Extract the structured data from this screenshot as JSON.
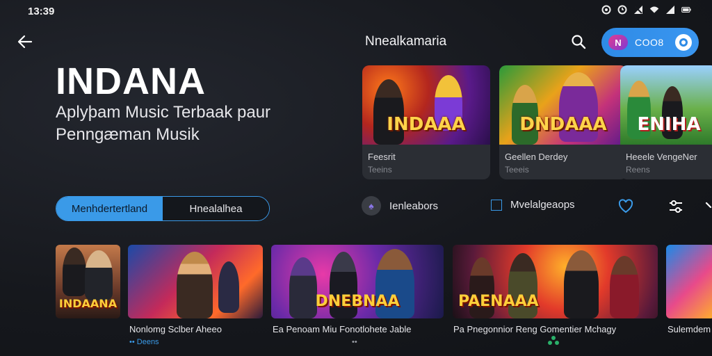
{
  "status_bar": {
    "time": "13:39"
  },
  "header": {
    "title": "Nnealkamaria",
    "account_code": "COO8",
    "account_badge": "N"
  },
  "hero": {
    "title": "INDANA",
    "subtitle": "Aplyþam Music Terbaak paur Penngæman Musik"
  },
  "segmented": {
    "option_1": "Menhdertertland",
    "option_2": "Hnealalhea"
  },
  "featured": [
    {
      "logo": "INDAAA",
      "line1": "Feesrit",
      "line2": "Teeins"
    },
    {
      "logo": "DNDAAA",
      "line1": "Geellen Derdey",
      "line2": "Teeeis"
    },
    {
      "logo": "ENIHA",
      "line1": "Heeele VengeNer",
      "line2": "Reens"
    }
  ],
  "actions": {
    "action_1": "Ienleabors",
    "action_2": "Mvelalgeaops"
  },
  "row": [
    {
      "logo": "INDAANA",
      "caption": "",
      "sub": ""
    },
    {
      "logo": "",
      "caption": "Nonlomg Sclber Aheeo",
      "sub": "•• Deens"
    },
    {
      "logo": "DNEBNAA",
      "caption": "Ea Penoam Miu Fonotlohete Jable",
      "sub": "••"
    },
    {
      "logo": "PAENAAA",
      "caption": "Pa Pnegonnior Reng Gomentier Mchagy",
      "sub": ""
    },
    {
      "logo": "",
      "caption": "Sulemdem",
      "sub": ""
    }
  ]
}
